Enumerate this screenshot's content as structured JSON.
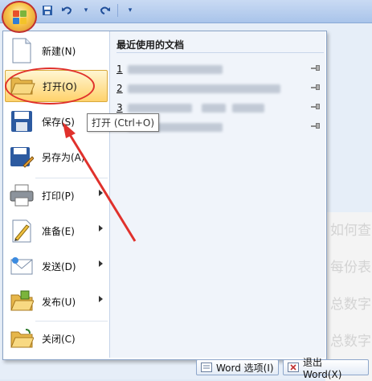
{
  "menu": {
    "items": [
      {
        "label": "新建(N)",
        "icon": "new-document-icon"
      },
      {
        "label": "打开(O)",
        "icon": "open-folder-icon"
      },
      {
        "label": "保存(S)",
        "icon": "save-icon"
      },
      {
        "label": "另存为(A)",
        "icon": "save-as-icon"
      },
      {
        "label": "打印(P)",
        "icon": "print-icon"
      },
      {
        "label": "准备(E)",
        "icon": "prepare-icon"
      },
      {
        "label": "发送(D)",
        "icon": "send-icon"
      },
      {
        "label": "发布(U)",
        "icon": "publish-icon"
      },
      {
        "label": "关闭(C)",
        "icon": "close-document-icon"
      }
    ],
    "tooltip": "打开 (Ctrl+O)"
  },
  "recent": {
    "title": "最近使用的文档",
    "items": [
      {
        "num": "1"
      },
      {
        "num": "2"
      },
      {
        "num": "3"
      },
      {
        "num": "4"
      }
    ]
  },
  "bottom": {
    "options_label": "Word 选项(I)",
    "exit_label": "退出 Word(X)"
  },
  "doc": {
    "lines": [
      "如何查",
      "每份表",
      "总数字",
      "总数字"
    ]
  },
  "colors": {
    "highlight": "#ffd26b",
    "annotation": "#e0312c"
  }
}
